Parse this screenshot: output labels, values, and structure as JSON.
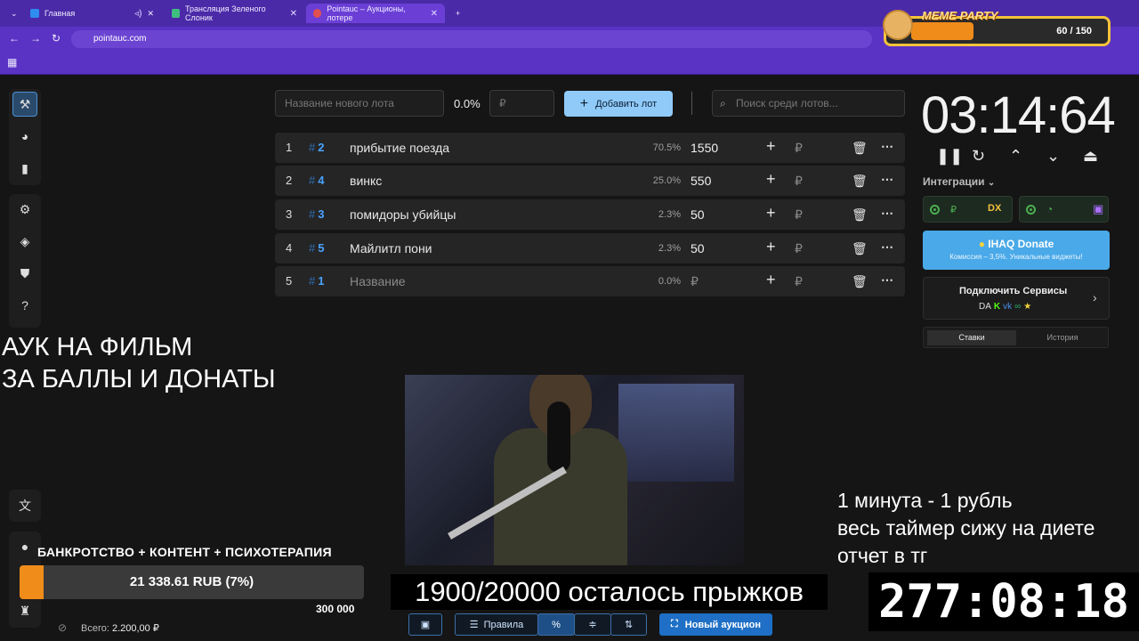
{
  "browser": {
    "tabs": [
      {
        "label": "Главная"
      },
      {
        "label": "Трансляция Зеленого Слоник"
      },
      {
        "label": "Pointauc – Аукционы, лотере"
      }
    ],
    "url": "pointauc.com"
  },
  "meme_party": {
    "title": "MEME PARTY",
    "count": "60 / 150"
  },
  "toolbar": {
    "new_lot_placeholder": "Название нового лота",
    "percent": "0.0%",
    "amount_placeholder": "₽",
    "add_button": "Добавить лот",
    "search_placeholder": "Поиск среди лотов..."
  },
  "lots": [
    {
      "n": "1",
      "id": "2",
      "name": "прибытие поезда",
      "pct": "70.5%",
      "amount": "1550"
    },
    {
      "n": "2",
      "id": "4",
      "name": "винкс",
      "pct": "25.0%",
      "amount": "550"
    },
    {
      "n": "3",
      "id": "3",
      "name": "помидоры убийцы",
      "pct": "2.3%",
      "amount": "50"
    },
    {
      "n": "4",
      "id": "5",
      "name": "Майлитл пони",
      "pct": "2.3%",
      "amount": "50"
    },
    {
      "n": "5",
      "id": "1",
      "name": "Название",
      "pct": "0.0%",
      "amount": "₽"
    }
  ],
  "lot_hash": "#",
  "currency": "₽",
  "timer": "03:14:64",
  "integrations_label": "Интеграции",
  "donate": {
    "title": "IHAQ Donate",
    "subtitle": "Комиссия – 3,5%. Уникальные виджеты!"
  },
  "connect_services": "Подключить Сервисы",
  "panel_tabs": {
    "bets": "Ставки",
    "history": "История"
  },
  "overlay": {
    "auk_line1": "АУК НА ФИЛЬМ",
    "auk_line2": "ЗА БАЛЛЫ И ДОНАТЫ",
    "jumps": "1900/20000 осталось прыжков",
    "rules_line1": "1 минута - 1 рубль",
    "rules_line2": "весь таймер сижу на диете",
    "rules_line3": "отчет в тг",
    "big_timer": "277:08:18"
  },
  "goal": {
    "title": "БАНКРОТСТВО + КОНТЕНТ + ПСИХОТЕРАПИЯ",
    "progress_text": "21 338.61 RUB (7%)",
    "progress": 0.07,
    "max": "300 000",
    "total_label": "Всего:",
    "total_value": "2.200,00 ₽"
  },
  "bottom_bar": {
    "rules": "Правила",
    "new_auction": "Новый аукцион"
  },
  "colors": {
    "accent": "#90caf9",
    "brand": "#5a33c4",
    "orange": "#f08c1a"
  }
}
